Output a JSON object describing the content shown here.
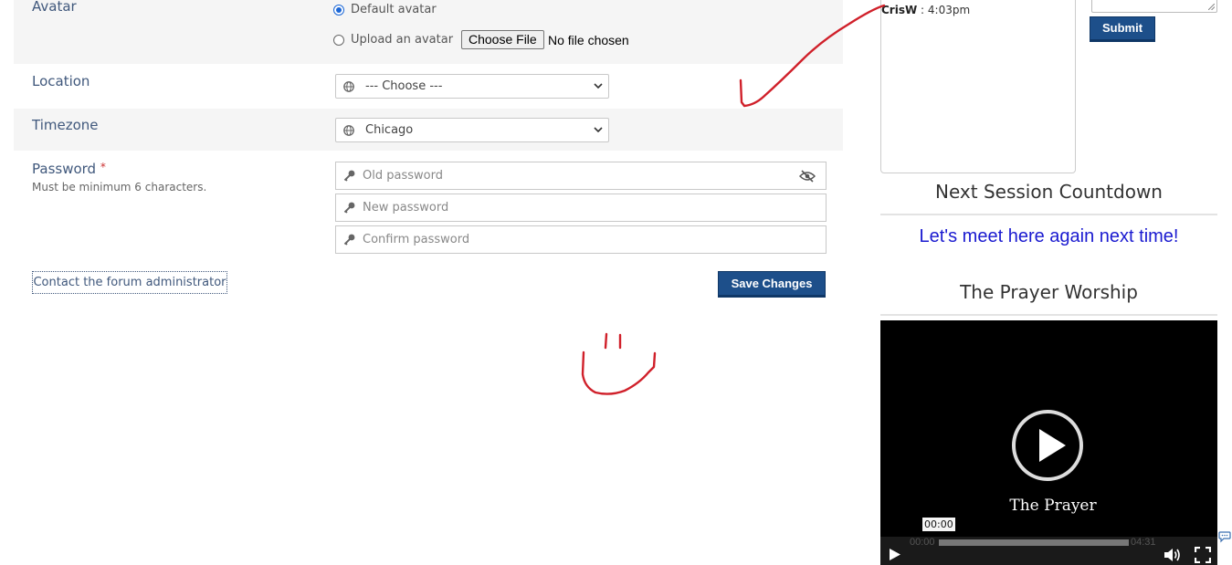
{
  "profile": {
    "avatar": {
      "label": "Avatar",
      "default_option": "Default avatar",
      "upload_option": "Upload an avatar",
      "file_button": "Choose File",
      "file_status": "No file chosen"
    },
    "location": {
      "label": "Location",
      "selected": "--- Choose ---"
    },
    "timezone": {
      "label": "Timezone",
      "selected": "Chicago"
    },
    "password": {
      "label": "Password",
      "required_mark": "*",
      "hint": "Must be minimum 6 characters.",
      "old_placeholder": "Old password",
      "new_placeholder": "New password",
      "confirm_placeholder": "Confirm password"
    },
    "contact_button": "Contact the forum administrator",
    "save_button": "Save Changes"
  },
  "chat": {
    "user": "CrisW",
    "separator": " : ",
    "time": "4:03pm",
    "submit_button": "Submit"
  },
  "countdown": {
    "title": "Next Session Countdown",
    "message": "Let's meet here again next time!"
  },
  "worship": {
    "title": "The Prayer Worship",
    "video": {
      "title": "The Prayer",
      "hover_time": "00:00",
      "current_time": "00:00",
      "duration": "04:31",
      "progress": 0
    }
  },
  "colors": {
    "label": "#40587c",
    "primary_button": "#1d4f8a",
    "link_blue": "#1a1ad0",
    "annotation_red": "#d0202a"
  }
}
